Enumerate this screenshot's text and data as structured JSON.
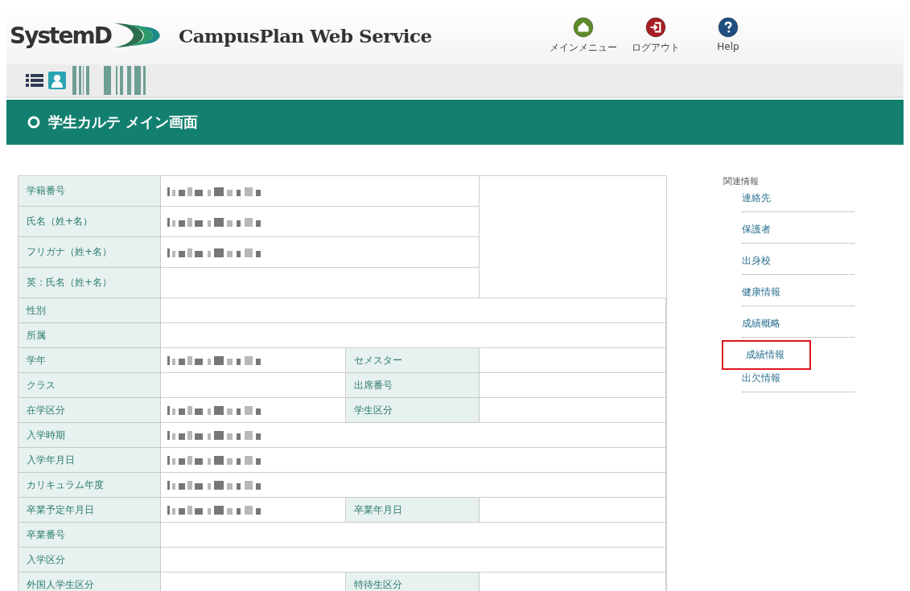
{
  "header": {
    "logo": "SystemD",
    "title": "CampusPlan Web Service",
    "nav": [
      {
        "kind": "home",
        "label": "メインメニュー"
      },
      {
        "kind": "logout",
        "label": "ログアウト"
      },
      {
        "kind": "help",
        "label": "Help"
      }
    ]
  },
  "banner": {
    "title": "学生カルテ メイン画面"
  },
  "record": {
    "rows": [
      {
        "kind": "top",
        "label": "学籍番号",
        "redacted": true
      },
      {
        "kind": "top",
        "label": "氏名（姓+名）",
        "redacted": true
      },
      {
        "kind": "top",
        "label": "フリガナ（姓+名）",
        "redacted": true
      },
      {
        "kind": "top",
        "label": "英：氏名（姓+名）",
        "redacted": false
      },
      {
        "kind": "wide",
        "label": "性別",
        "redacted": false
      },
      {
        "kind": "wide",
        "label": "所属",
        "redacted": false
      },
      {
        "kind": "pair",
        "label": "学年",
        "redacted": true,
        "label_2": "セメスター"
      },
      {
        "kind": "pair",
        "label": "クラス",
        "redacted": false,
        "label_2": "出席番号"
      },
      {
        "kind": "pair",
        "label": "在学区分",
        "redacted": true,
        "label_2": "学生区分"
      },
      {
        "kind": "wide",
        "label": "入学時期",
        "redacted": true
      },
      {
        "kind": "wide",
        "label": "入学年月日",
        "redacted": true
      },
      {
        "kind": "wide",
        "label": "カリキュラム年度",
        "redacted": true
      },
      {
        "kind": "pair",
        "label": "卒業予定年月日",
        "redacted": true,
        "label_2": "卒業年月日"
      },
      {
        "kind": "wide",
        "label": "卒業番号",
        "redacted": false
      },
      {
        "kind": "wide",
        "label": "入学区分",
        "redacted": false
      },
      {
        "kind": "pair",
        "label": "外国人学生区分",
        "redacted": false,
        "label_2": "特待生区分"
      }
    ]
  },
  "related": {
    "title": "関連情報",
    "links": [
      {
        "label": "連絡先",
        "highlighted": false
      },
      {
        "label": "保護者",
        "highlighted": false
      },
      {
        "label": "出身校",
        "highlighted": false
      },
      {
        "label": "健康情報",
        "highlighted": false
      },
      {
        "label": "成績概略",
        "highlighted": false
      },
      {
        "label": "成績情報",
        "highlighted": true
      },
      {
        "label": "出欠情報",
        "highlighted": false
      }
    ]
  }
}
